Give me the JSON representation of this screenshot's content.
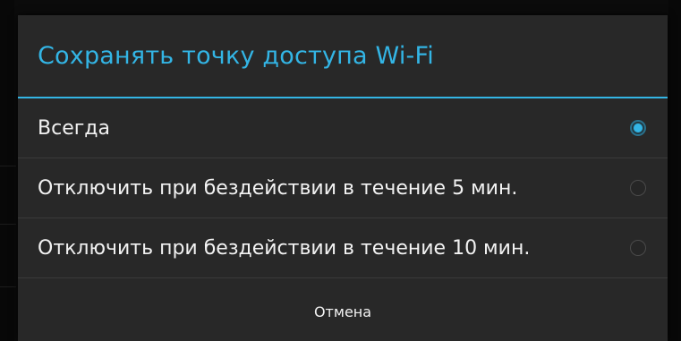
{
  "dialog": {
    "title": "Сохранять точку доступа Wi-Fi",
    "accent_color": "#33b5e5",
    "options": [
      {
        "label": "Всегда",
        "selected": true
      },
      {
        "label": "Отключить при бездействии в течение 5 мин.",
        "selected": false
      },
      {
        "label": "Отключить при бездействии в течение 10 мин.",
        "selected": false
      }
    ],
    "cancel_label": "Отмена"
  }
}
